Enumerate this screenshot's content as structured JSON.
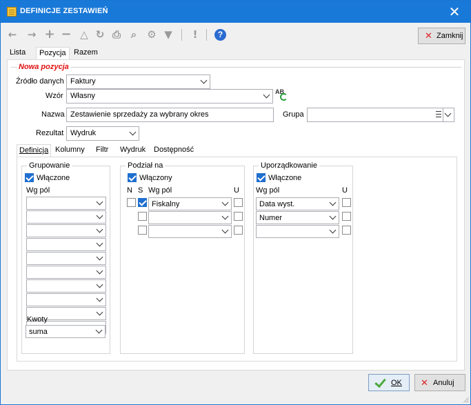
{
  "window": {
    "title": "DEFINICJE ZESTAWIEŃ",
    "close_glyph": "✕"
  },
  "toolbar": {
    "icons": [
      "arrow-left-icon",
      "arrow-right-icon",
      "plus-icon",
      "minus-icon",
      "triangle-icon",
      "refresh-icon",
      "print-icon",
      "zoom-icon",
      "gears-icon",
      "filter-icon",
      "exclamation-icon",
      "help-icon"
    ],
    "close_label": "Zamknij",
    "close_glyph": "✕",
    "help_glyph": "?"
  },
  "top_tabs": [
    "Lista",
    "Pozycja",
    "Razem"
  ],
  "top_tabs_active": "Pozycja",
  "section": {
    "title": "Nowa pozycja"
  },
  "form": {
    "zrodlo_label": "Źródło danych",
    "zrodlo_value": "Faktury",
    "wzor_label": "Wzór",
    "wzor_value": "Własny",
    "nazwa_label": "Nazwa",
    "nazwa_value": "Zestawienie sprzedaży za wybrany okres",
    "grupa_label": "Grupa",
    "grupa_value": "",
    "rezultat_label": "Rezultat",
    "rezultat_value": "Wydruk",
    "ab_icon_text": "AB"
  },
  "sub_tabs": [
    "Definicja",
    "Kolumny",
    "Filtr",
    "Wydruk",
    "Dostępność"
  ],
  "sub_tabs_active": "Definicja",
  "grupowanie": {
    "title": "Grupowanie",
    "enabled_label": "Włączone",
    "enabled": true,
    "fields_label": "Wg pól",
    "fields": [
      "",
      "",
      "",
      "",
      "",
      "",
      "",
      "",
      "",
      ""
    ],
    "kwoty_label": "Kwoty",
    "kwoty_value": "suma"
  },
  "podzial": {
    "title": "Podział na",
    "enabled_label": "Włączony",
    "enabled": true,
    "col_n": "N",
    "col_s": "S",
    "fields_label": "Wg pól",
    "col_u": "U",
    "rows": [
      {
        "s": true,
        "value": "Fiskalny",
        "u": false
      },
      {
        "s": false,
        "value": "",
        "u": false
      },
      {
        "s": false,
        "value": "",
        "u": false
      }
    ]
  },
  "uporzadkowanie": {
    "title": "Uporządkowanie",
    "enabled_label": "Włączone",
    "enabled": true,
    "fields_label": "Wg pól",
    "col_u": "U",
    "rows": [
      {
        "value": "Data wyst.",
        "u": false
      },
      {
        "value": "Numer",
        "u": false
      },
      {
        "value": "",
        "u": false
      }
    ]
  },
  "footer": {
    "ok_label": "OK",
    "cancel_label": "Anuluj",
    "cancel_glyph": "✕"
  },
  "colors": {
    "titlebar": "#1979d8",
    "accent": "#1f6fcf",
    "section_title": "#e01010",
    "ok_check": "#4caa3c",
    "close_x": "#dd2222"
  }
}
